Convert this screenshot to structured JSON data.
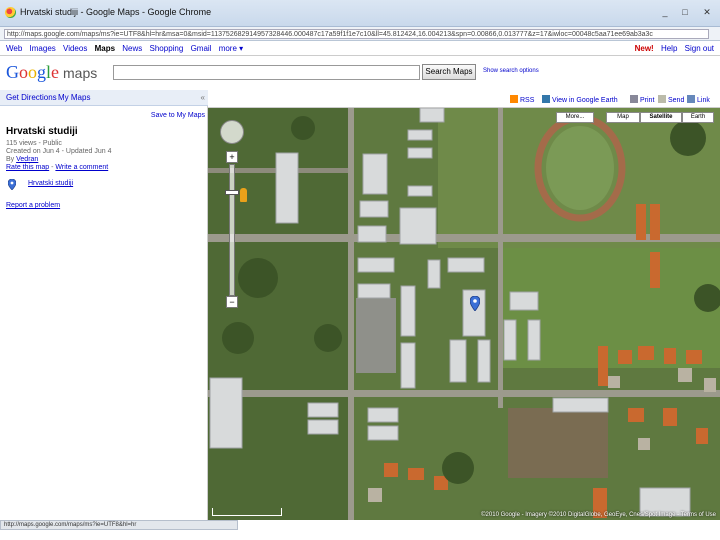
{
  "browser": {
    "tab_title": "Hrvatski studiji - Google Maps - Google Chrome",
    "url": "http://maps.google.com/maps/ms?ie=UTF8&hl=hr&msa=0&msid=113752682914957328446.000487c17a59f1f1e7c10&ll=45.812424,16.004213&spn=0.00866,0.013777&z=17&iwloc=00048c5aa71ee69ab3a3c",
    "status_url": "http://maps.google.com/maps/ms?ie=UTF8&hl=hr",
    "controls": {
      "minimize": "_",
      "maximize": "□",
      "close": "✕"
    }
  },
  "gbar": {
    "links": [
      "Web",
      "Images",
      "Videos",
      "Maps",
      "News",
      "Shopping",
      "Gmail",
      "more ▾"
    ],
    "active": "Maps",
    "right": {
      "new": "New!",
      "help": "Help",
      "signout": "Sign out"
    }
  },
  "header": {
    "logo_letters": [
      "G",
      "o",
      "o",
      "g",
      "l",
      "e"
    ],
    "logo_suffix": "maps",
    "search_value": "",
    "search_button": "Search Maps",
    "search_options": "Show search options"
  },
  "left_panel": {
    "tab_directions": "Get Directions",
    "tab_mymaps": "My Maps",
    "collapse": "«",
    "save_link": "Save to My Maps",
    "map_title": "Hrvatski studiji",
    "views": "115 views - Public",
    "created": "Created on Jun 4 - Updated Jun 4",
    "by_prefix": "By",
    "by_user": "Vedran",
    "rate": "Rate this map",
    "separator": " - ",
    "comment": "Write a comment",
    "place": "Hrvatski studiji",
    "report": "Report a problem"
  },
  "map_toolbar": {
    "rss": "RSS",
    "view_in_earth": "View in Google Earth",
    "print": "Print",
    "send": "Send",
    "link": "Link"
  },
  "map_types": [
    "More...",
    "Map",
    "Satellite",
    "Earth"
  ],
  "map_type_selected": "Satellite",
  "map": {
    "copyright": "©2010 Google - Imagery ©2010 DigitalGlobe, GeoEye, Cnes/Spot Image - Terms of Use"
  },
  "colors": {
    "link": "#0000cc",
    "panel_bar": "#e8eef7",
    "marker": "#3b6fd6"
  }
}
